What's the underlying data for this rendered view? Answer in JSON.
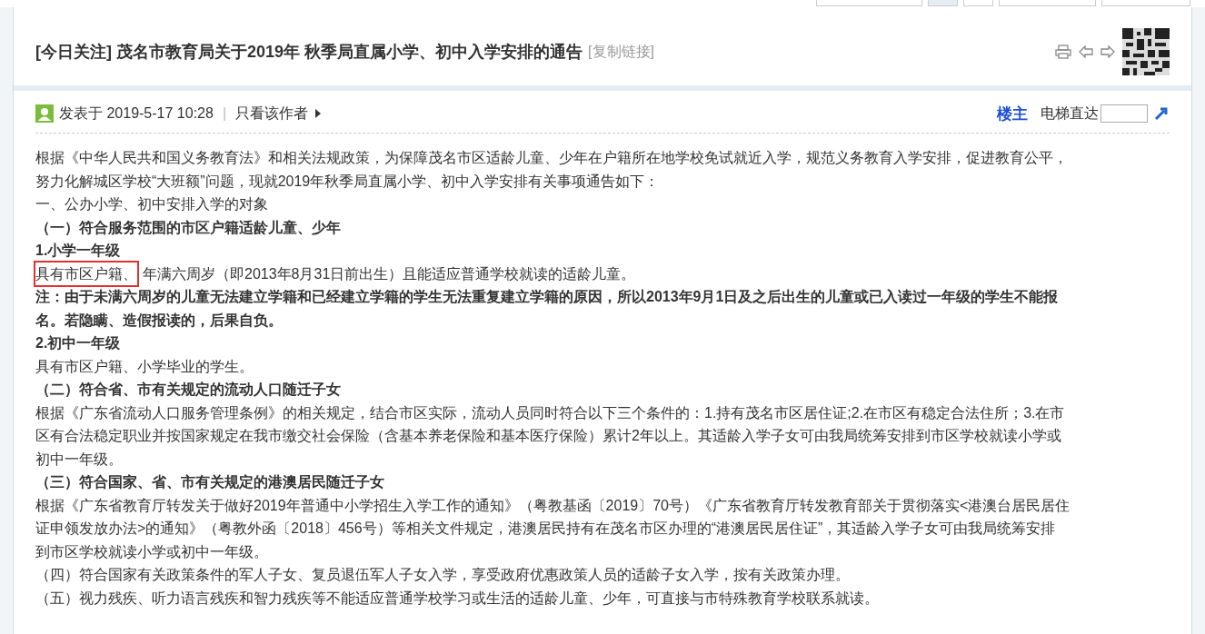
{
  "thread": {
    "tag": "[今日关注]",
    "title": "茂名市教育局关于2019年 秋季局直属小学、初中入学安排的通告",
    "copy_link": "[复制链接]"
  },
  "post_info": {
    "posted": "发表于 2019-5-17 10:28",
    "separator": "|",
    "author_only": "只看该作者",
    "floor": "楼主",
    "jump_label": "电梯直达"
  },
  "content": [
    {
      "kind": "text",
      "lines": [
        "根据《中华人民共和国义务教育法》和相关法规政策，为保障茂名市区适龄儿童、少年在户籍所在地学校免试就近入学，规范义务教育入学安排，促进教育公平，",
        "努力化解城区学校“大班额”问题，现就2019年秋季局直属小学、初中入学安排有关事项通告如下："
      ]
    },
    {
      "kind": "text",
      "lines": [
        "一、公办小学、初中安排入学的对象"
      ]
    },
    {
      "kind": "bold",
      "lines": [
        "（一）符合服务范围的市区户籍适龄儿童、少年"
      ]
    },
    {
      "kind": "bold",
      "lines": [
        "1.小学一年级"
      ]
    },
    {
      "kind": "highlighted",
      "highlight": "具有市区户籍、",
      "lines": [
        "年满六周岁（即2013年8月31日前出生）且能适应普通学校就读的适龄儿童。"
      ]
    },
    {
      "kind": "bold",
      "lines": [
        "注：由于未满六周岁的儿童无法建立学籍和已经建立学籍的学生无法重复建立学籍的原因，所以2013年9月1日及之后出生的儿童或已入读过一年级的学生不能报",
        "名。若隐瞒、造假报读的，后果自负。"
      ]
    },
    {
      "kind": "bold",
      "lines": [
        "2.初中一年级"
      ]
    },
    {
      "kind": "text",
      "lines": [
        "具有市区户籍、小学毕业的学生。"
      ]
    },
    {
      "kind": "bold",
      "lines": [
        "（二）符合省、市有关规定的流动人口随迁子女"
      ]
    },
    {
      "kind": "text",
      "lines": [
        "根据《广东省流动人口服务管理条例》的相关规定，结合市区实际，流动人员同时符合以下三个条件的：1.持有茂名市区居住证;2.在市区有稳定合法住所；3.在市",
        "区有合法稳定职业并按国家规定在我市缴交社会保险（含基本养老保险和基本医疗保险）累计2年以上。其适龄入学子女可由我局统筹安排到市区学校就读小学或",
        "初中一年级。"
      ]
    },
    {
      "kind": "bold",
      "lines": [
        "（三）符合国家、省、市有关规定的港澳居民随迁子女"
      ]
    },
    {
      "kind": "text",
      "lines": [
        "根据《广东省教育厅转发关于做好2019年普通中小学招生入学工作的通知》（粤教基函〔2019〕70号）《广东省教育厅转发教育部关于贯彻落实<港澳台居民居住",
        "证申领发放办法>的通知》（粤教外函〔2018〕456号）等相关文件规定，港澳居民持有在茂名市区办理的“港澳居民居住证”，其适龄入学子女可由我局统筹安排",
        "到市区学校就读小学或初中一年级。"
      ]
    },
    {
      "kind": "text",
      "lines": [
        "（四）符合国家有关政策条件的军人子女、复员退伍军人子女入学，享受政府优惠政策人员的适龄子女入学，按有关政策办理。"
      ]
    },
    {
      "kind": "text",
      "lines": [
        "（五）视力残疾、听力语言残疾和智力残疾等不能适应普通学校学习或生活的适龄儿童、少年，可直接与市特殊教育学校联系就读。"
      ]
    }
  ]
}
